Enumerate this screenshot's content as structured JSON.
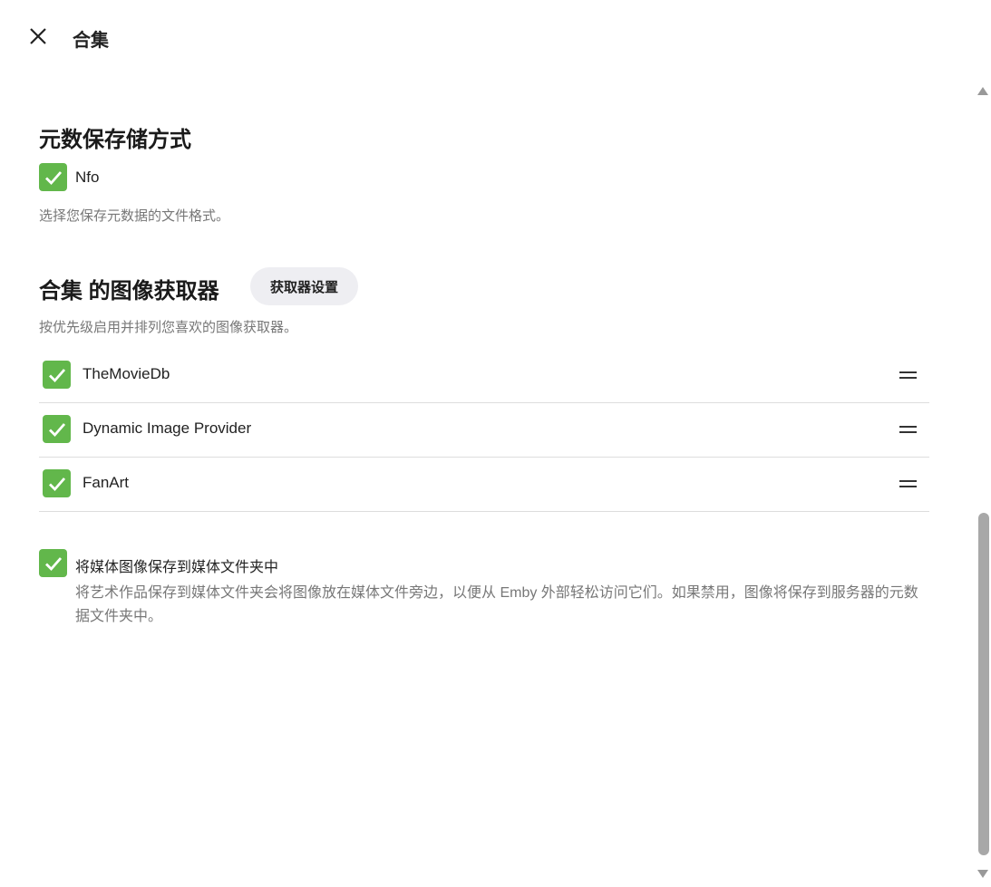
{
  "header": {
    "title": "合集"
  },
  "metadata_savers": {
    "heading": "元数保存储方式",
    "option": {
      "label": "Nfo",
      "checked": true
    },
    "description": "选择您保存元数据的文件格式。"
  },
  "image_fetchers": {
    "heading": "合集 的图像获取器",
    "settings_button": "获取器设置",
    "description": "按优先级启用并排列您喜欢的图像获取器。",
    "items": [
      {
        "label": "TheMovieDb",
        "checked": true
      },
      {
        "label": "Dynamic Image Provider",
        "checked": true
      },
      {
        "label": "FanArt",
        "checked": true
      }
    ]
  },
  "save_local": {
    "label": "将媒体图像保存到媒体文件夹中",
    "checked": true,
    "description": "将艺术作品保存到媒体文件夹会将图像放在媒体文件旁边，以便从 Emby 外部轻松访问它们。如果禁用，图像将保存到服务器的元数据文件夹中。"
  },
  "colors": {
    "accent": "#62b74b"
  }
}
